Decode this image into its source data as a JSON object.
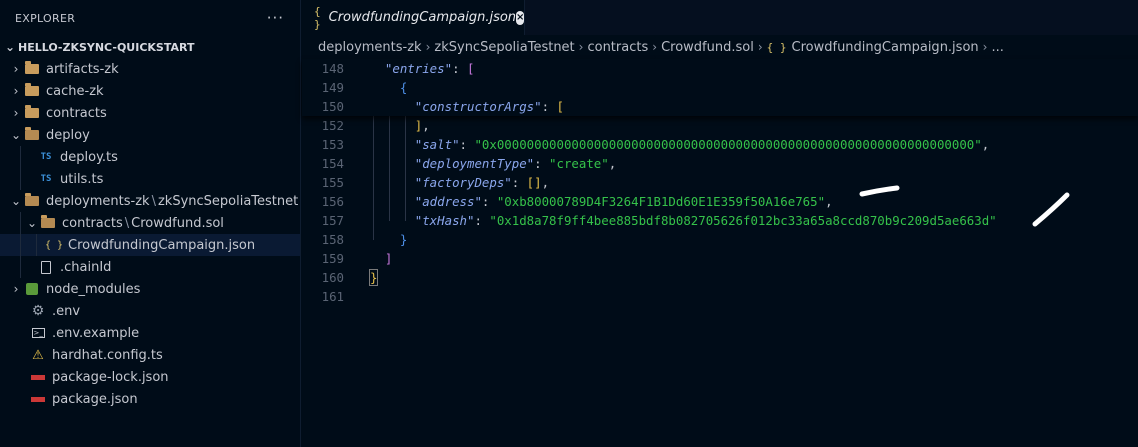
{
  "sidebar": {
    "title": "EXPLORER",
    "more_label": "···",
    "project": "HELLO-ZKSYNC-QUICKSTART",
    "items": [
      {
        "label": "artifacts-zk",
        "icon": "folder-icon",
        "chevron": "›"
      },
      {
        "label": "cache-zk",
        "icon": "folder-icon",
        "chevron": "›"
      },
      {
        "label": "contracts",
        "icon": "folder-icon",
        "chevron": "›"
      },
      {
        "label": "deploy",
        "icon": "folder-open-icon",
        "chevron": "⌄"
      },
      {
        "label": "deploy.ts",
        "icon": "typescript-icon",
        "icon_text": "TS"
      },
      {
        "label": "utils.ts",
        "icon": "typescript-icon",
        "icon_text": "TS"
      },
      {
        "label_a": "deployments-zk",
        "label_b": "zkSyncSepoliaTestnet",
        "icon": "folder-open-icon",
        "chevron": "⌄"
      },
      {
        "label_a": "contracts",
        "label_b": "Crowdfund.sol",
        "icon": "folder-open-icon",
        "chevron": "⌄"
      },
      {
        "label": "CrowdfundingCampaign.json",
        "icon": "json-icon",
        "icon_text": "{ }"
      },
      {
        "label": ".chainId",
        "icon": "file-icon"
      },
      {
        "label": "node_modules",
        "icon": "node-folder-icon",
        "chevron": "›"
      },
      {
        "label": ".env",
        "icon": "gear-icon"
      },
      {
        "label": ".env.example",
        "icon": "terminal-icon"
      },
      {
        "label": "hardhat.config.ts",
        "icon": "warning-icon"
      },
      {
        "label": "package-lock.json",
        "icon": "npm-icon"
      },
      {
        "label": "package.json",
        "icon": "npm-icon"
      }
    ],
    "path_separator": "\\"
  },
  "editor": {
    "tab": {
      "icon_text": "{ }",
      "label": "CrowdfundingCampaign.json",
      "close": "×"
    },
    "breadcrumb": {
      "parts": [
        "deployments-zk",
        "zkSyncSepoliaTestnet",
        "contracts",
        "Crowdfund.sol",
        "CrowdfundingCampaign.json",
        "..."
      ],
      "json_icon": "{ }",
      "chevron": "›"
    },
    "lines": [
      {
        "n": "148",
        "indent": "  ",
        "key": "\"entries\"",
        "colon": ": ",
        "br": "["
      },
      {
        "n": "149",
        "indent": "    ",
        "br": "{"
      },
      {
        "n": "150",
        "indent": "      ",
        "key": "\"constructorArgs\"",
        "colon": ": ",
        "br": "["
      },
      {
        "n": "152",
        "indent": "      ",
        "br": "]",
        "tail": ","
      },
      {
        "n": "153",
        "indent": "      ",
        "key": "\"salt\"",
        "colon": ": ",
        "str": "\"0x0000000000000000000000000000000000000000000000000000000000000000\"",
        "tail": ","
      },
      {
        "n": "154",
        "indent": "      ",
        "key": "\"deploymentType\"",
        "colon": ": ",
        "str": "\"create\"",
        "tail": ","
      },
      {
        "n": "155",
        "indent": "      ",
        "key": "\"factoryDeps\"",
        "colon": ": ",
        "br": "[]",
        "tail": ","
      },
      {
        "n": "156",
        "indent": "      ",
        "key": "\"address\"",
        "colon": ": ",
        "str": "\"0xb80000789D4F3264F1B1Dd60E1E359f50A16e765\"",
        "tail": ","
      },
      {
        "n": "157",
        "indent": "      ",
        "key": "\"txHash\"",
        "colon": ": ",
        "str": "\"0x1d8a78f9ff4bee885bdf8b082705626f012bc33a65a8ccd870b9c209d5ae663d\""
      },
      {
        "n": "158",
        "indent": "    ",
        "br": "}"
      },
      {
        "n": "159",
        "indent": "  ",
        "br": "]"
      },
      {
        "n": "160",
        "indent": "",
        "br": "}"
      },
      {
        "n": "161",
        "indent": ""
      }
    ]
  },
  "colors": {
    "background": "#000c18",
    "json_key": "#8aa6ec",
    "json_string": "#35c24a",
    "bracket_yellow": "#e6c04a",
    "bracket_purple": "#c678dd",
    "bracket_blue": "#4d8fe6"
  }
}
